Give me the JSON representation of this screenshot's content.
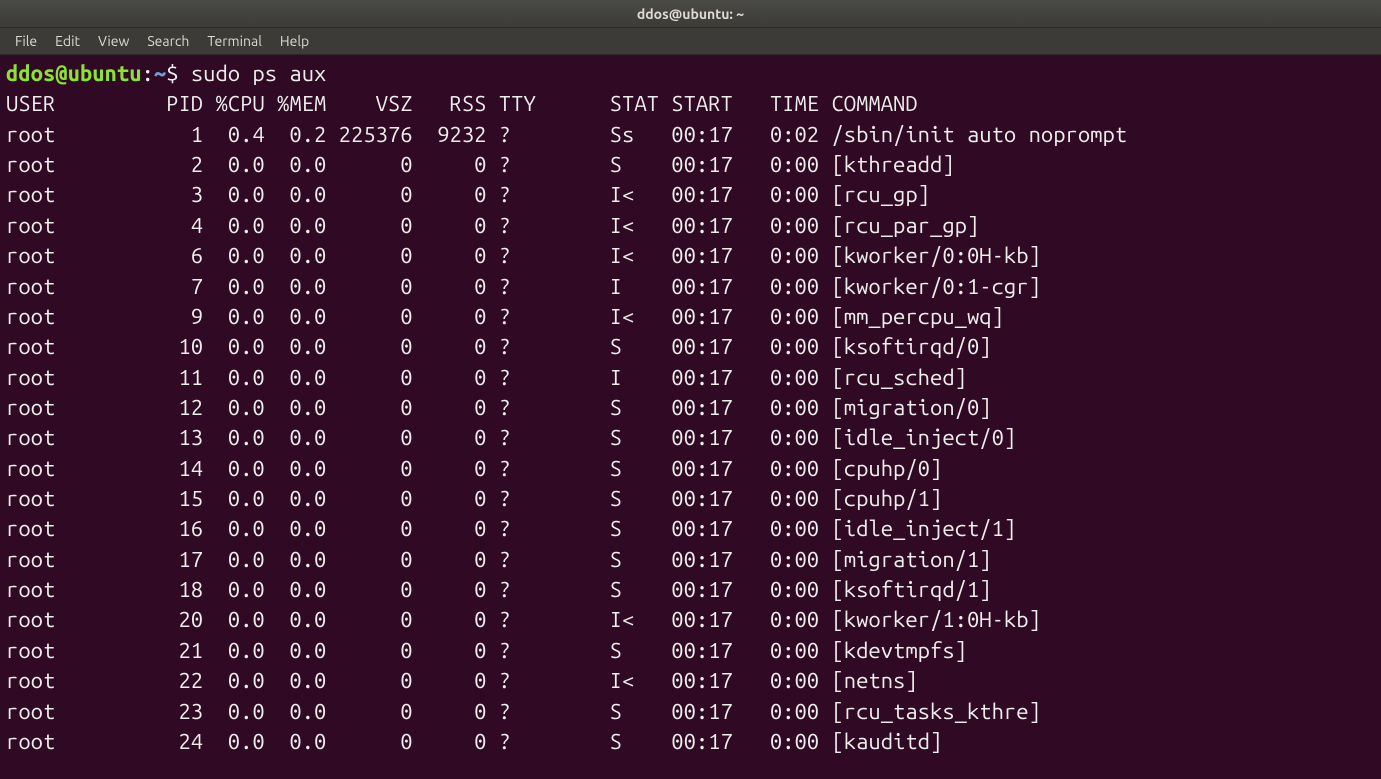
{
  "titlebar": {
    "title": "ddos@ubuntu: ~"
  },
  "menubar": {
    "items": [
      "File",
      "Edit",
      "View",
      "Search",
      "Terminal",
      "Help"
    ]
  },
  "prompt": {
    "user_host": "ddos@ubuntu",
    "sep": ":",
    "path": "~",
    "symbol": "$ ",
    "command": "sudo ps aux"
  },
  "ps": {
    "headers": [
      "USER",
      "PID",
      "%CPU",
      "%MEM",
      "VSZ",
      "RSS",
      "TTY",
      "STAT",
      "START",
      "TIME",
      "COMMAND"
    ],
    "rows": [
      {
        "user": "root",
        "pid": "1",
        "cpu": "0.4",
        "mem": "0.2",
        "vsz": "225376",
        "rss": "9232",
        "tty": "?",
        "stat": "Ss",
        "start": "00:17",
        "time": "0:02",
        "command": "/sbin/init auto noprompt"
      },
      {
        "user": "root",
        "pid": "2",
        "cpu": "0.0",
        "mem": "0.0",
        "vsz": "0",
        "rss": "0",
        "tty": "?",
        "stat": "S",
        "start": "00:17",
        "time": "0:00",
        "command": "[kthreadd]"
      },
      {
        "user": "root",
        "pid": "3",
        "cpu": "0.0",
        "mem": "0.0",
        "vsz": "0",
        "rss": "0",
        "tty": "?",
        "stat": "I<",
        "start": "00:17",
        "time": "0:00",
        "command": "[rcu_gp]"
      },
      {
        "user": "root",
        "pid": "4",
        "cpu": "0.0",
        "mem": "0.0",
        "vsz": "0",
        "rss": "0",
        "tty": "?",
        "stat": "I<",
        "start": "00:17",
        "time": "0:00",
        "command": "[rcu_par_gp]"
      },
      {
        "user": "root",
        "pid": "6",
        "cpu": "0.0",
        "mem": "0.0",
        "vsz": "0",
        "rss": "0",
        "tty": "?",
        "stat": "I<",
        "start": "00:17",
        "time": "0:00",
        "command": "[kworker/0:0H-kb]"
      },
      {
        "user": "root",
        "pid": "7",
        "cpu": "0.0",
        "mem": "0.0",
        "vsz": "0",
        "rss": "0",
        "tty": "?",
        "stat": "I",
        "start": "00:17",
        "time": "0:00",
        "command": "[kworker/0:1-cgr]"
      },
      {
        "user": "root",
        "pid": "9",
        "cpu": "0.0",
        "mem": "0.0",
        "vsz": "0",
        "rss": "0",
        "tty": "?",
        "stat": "I<",
        "start": "00:17",
        "time": "0:00",
        "command": "[mm_percpu_wq]"
      },
      {
        "user": "root",
        "pid": "10",
        "cpu": "0.0",
        "mem": "0.0",
        "vsz": "0",
        "rss": "0",
        "tty": "?",
        "stat": "S",
        "start": "00:17",
        "time": "0:00",
        "command": "[ksoftirqd/0]"
      },
      {
        "user": "root",
        "pid": "11",
        "cpu": "0.0",
        "mem": "0.0",
        "vsz": "0",
        "rss": "0",
        "tty": "?",
        "stat": "I",
        "start": "00:17",
        "time": "0:00",
        "command": "[rcu_sched]"
      },
      {
        "user": "root",
        "pid": "12",
        "cpu": "0.0",
        "mem": "0.0",
        "vsz": "0",
        "rss": "0",
        "tty": "?",
        "stat": "S",
        "start": "00:17",
        "time": "0:00",
        "command": "[migration/0]"
      },
      {
        "user": "root",
        "pid": "13",
        "cpu": "0.0",
        "mem": "0.0",
        "vsz": "0",
        "rss": "0",
        "tty": "?",
        "stat": "S",
        "start": "00:17",
        "time": "0:00",
        "command": "[idle_inject/0]"
      },
      {
        "user": "root",
        "pid": "14",
        "cpu": "0.0",
        "mem": "0.0",
        "vsz": "0",
        "rss": "0",
        "tty": "?",
        "stat": "S",
        "start": "00:17",
        "time": "0:00",
        "command": "[cpuhp/0]"
      },
      {
        "user": "root",
        "pid": "15",
        "cpu": "0.0",
        "mem": "0.0",
        "vsz": "0",
        "rss": "0",
        "tty": "?",
        "stat": "S",
        "start": "00:17",
        "time": "0:00",
        "command": "[cpuhp/1]"
      },
      {
        "user": "root",
        "pid": "16",
        "cpu": "0.0",
        "mem": "0.0",
        "vsz": "0",
        "rss": "0",
        "tty": "?",
        "stat": "S",
        "start": "00:17",
        "time": "0:00",
        "command": "[idle_inject/1]"
      },
      {
        "user": "root",
        "pid": "17",
        "cpu": "0.0",
        "mem": "0.0",
        "vsz": "0",
        "rss": "0",
        "tty": "?",
        "stat": "S",
        "start": "00:17",
        "time": "0:00",
        "command": "[migration/1]"
      },
      {
        "user": "root",
        "pid": "18",
        "cpu": "0.0",
        "mem": "0.0",
        "vsz": "0",
        "rss": "0",
        "tty": "?",
        "stat": "S",
        "start": "00:17",
        "time": "0:00",
        "command": "[ksoftirqd/1]"
      },
      {
        "user": "root",
        "pid": "20",
        "cpu": "0.0",
        "mem": "0.0",
        "vsz": "0",
        "rss": "0",
        "tty": "?",
        "stat": "I<",
        "start": "00:17",
        "time": "0:00",
        "command": "[kworker/1:0H-kb]"
      },
      {
        "user": "root",
        "pid": "21",
        "cpu": "0.0",
        "mem": "0.0",
        "vsz": "0",
        "rss": "0",
        "tty": "?",
        "stat": "S",
        "start": "00:17",
        "time": "0:00",
        "command": "[kdevtmpfs]"
      },
      {
        "user": "root",
        "pid": "22",
        "cpu": "0.0",
        "mem": "0.0",
        "vsz": "0",
        "rss": "0",
        "tty": "?",
        "stat": "I<",
        "start": "00:17",
        "time": "0:00",
        "command": "[netns]"
      },
      {
        "user": "root",
        "pid": "23",
        "cpu": "0.0",
        "mem": "0.0",
        "vsz": "0",
        "rss": "0",
        "tty": "?",
        "stat": "S",
        "start": "00:17",
        "time": "0:00",
        "command": "[rcu_tasks_kthre]"
      },
      {
        "user": "root",
        "pid": "24",
        "cpu": "0.0",
        "mem": "0.0",
        "vsz": "0",
        "rss": "0",
        "tty": "?",
        "stat": "S",
        "start": "00:17",
        "time": "0:00",
        "command": "[kauditd]"
      }
    ]
  }
}
